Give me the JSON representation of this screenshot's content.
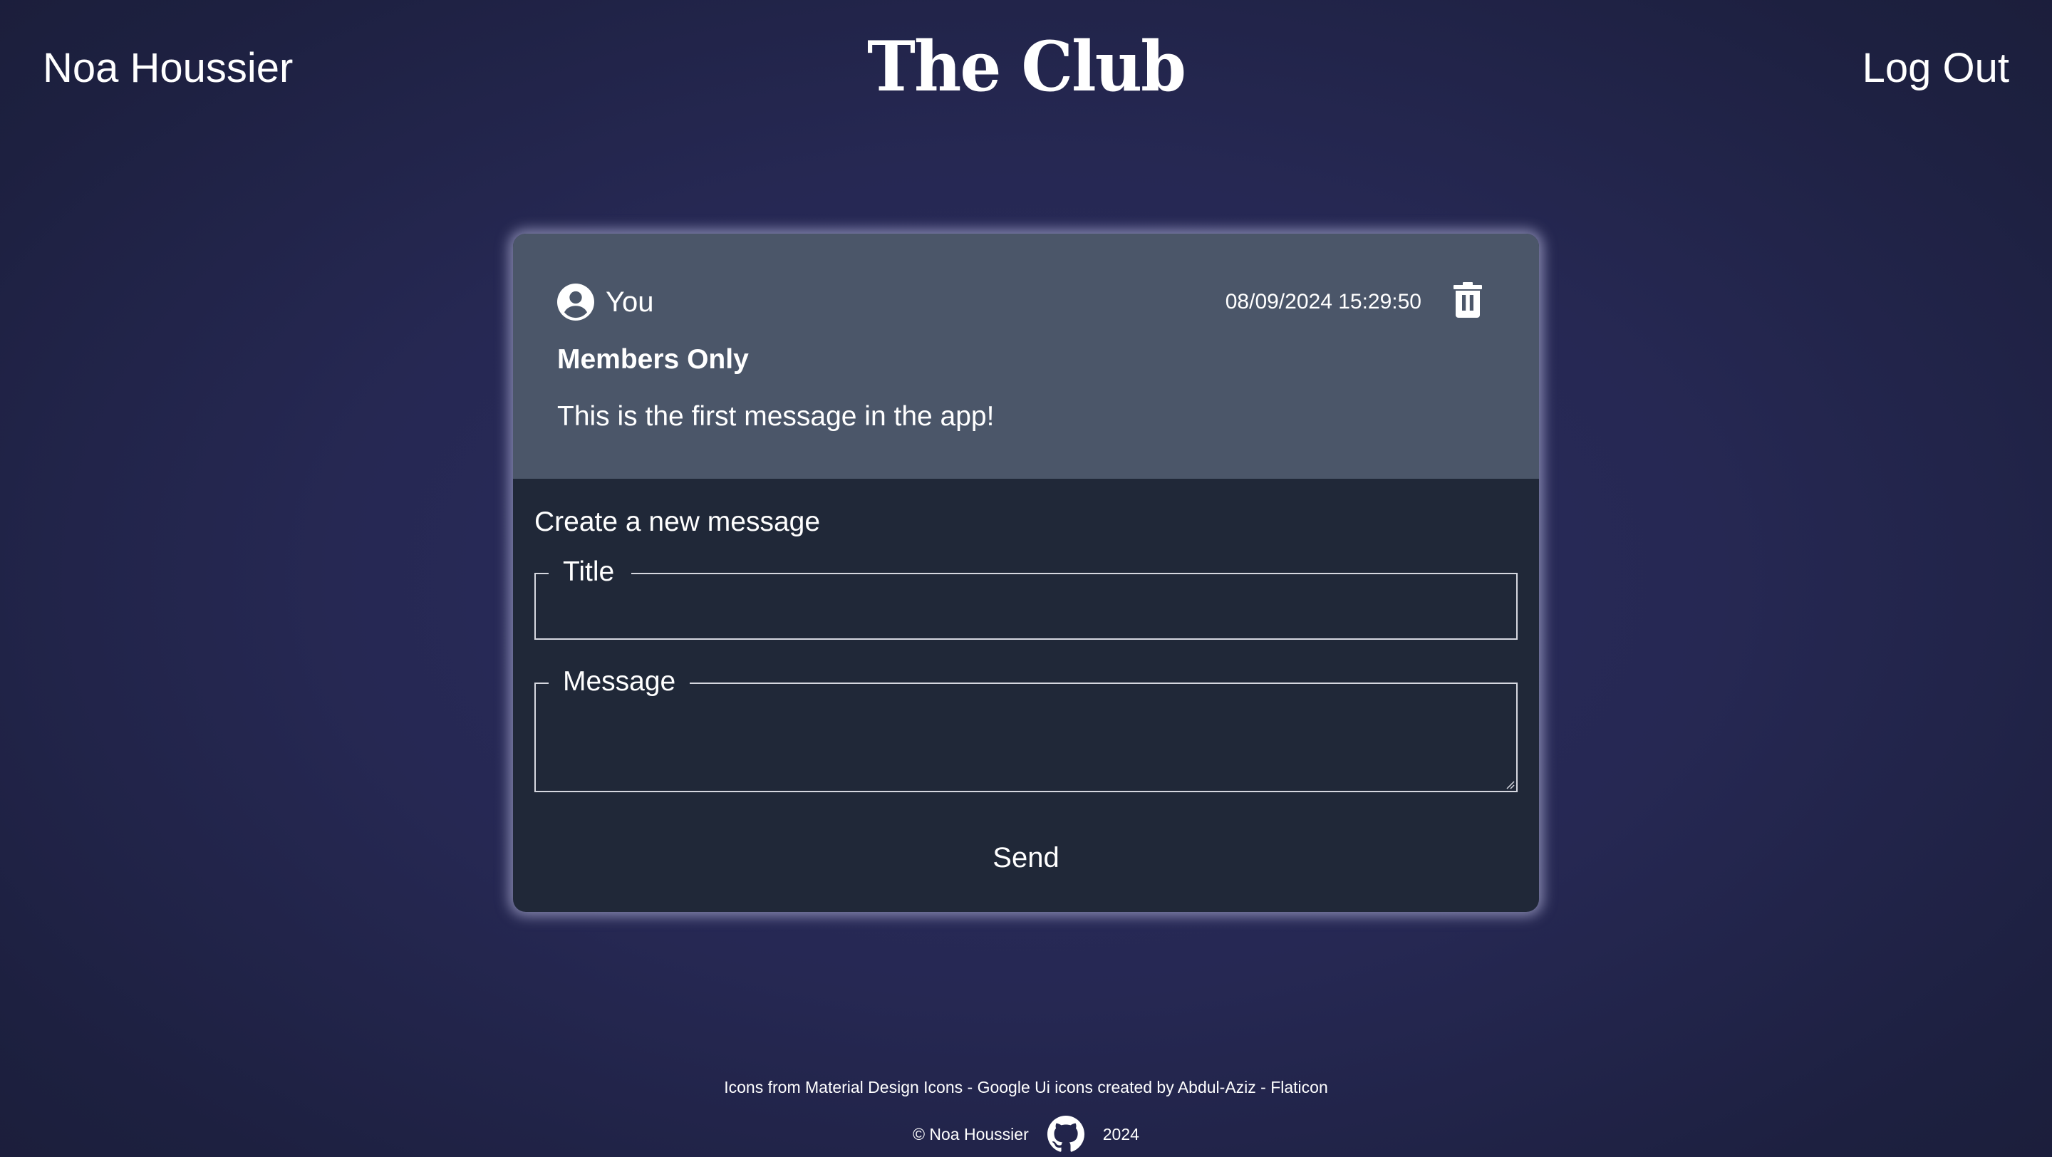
{
  "header": {
    "user_name": "Noa Houssier",
    "logo": "The Club",
    "logout_label": "Log Out"
  },
  "message": {
    "author": "You",
    "author_icon": "account-circle-icon",
    "date": "08/09/2024 15:29:50",
    "delete_icon": "trash-icon",
    "title": "Members Only",
    "body": "This is the first message in the app!"
  },
  "form": {
    "heading": "Create a new message",
    "title_label": "Title",
    "title_value": "",
    "message_label": "Message",
    "message_value": "",
    "send_label": "Send"
  },
  "footer": {
    "credits": "Icons from Material Design Icons - Google Ui icons created by Abdul-Aziz - Flaticon",
    "copyright": "© Noa Houssier",
    "github_icon": "github-icon",
    "year": "2024"
  },
  "colors": {
    "background": "#262853",
    "message_bg": "#4b5669",
    "form_bg": "#202838",
    "text": "#ffffff"
  }
}
